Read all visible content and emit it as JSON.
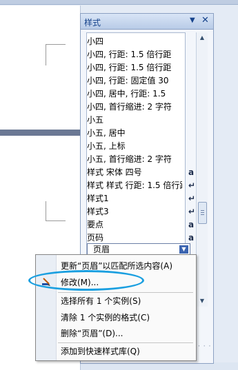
{
  "pane": {
    "title": "样式",
    "dropdown_glyph": "▼",
    "close_glyph": "✕"
  },
  "styles": [
    {
      "label": "小四",
      "mark": ""
    },
    {
      "label": "小四, 行距: 1.5 倍行距",
      "mark": ""
    },
    {
      "label": "小四, 行距: 1.5 倍行距",
      "mark": ""
    },
    {
      "label": "小四, 行距: 固定值 30",
      "mark": ""
    },
    {
      "label": "小四, 居中, 行距: 1.5",
      "mark": ""
    },
    {
      "label": "小四, 首行缩进: 2 字符",
      "mark": ""
    },
    {
      "label": "小五",
      "mark": ""
    },
    {
      "label": "小五, 居中",
      "mark": ""
    },
    {
      "label": "小五, 上标",
      "mark": ""
    },
    {
      "label": "小五, 首行缩进: 2 字符",
      "mark": ""
    },
    {
      "label": "样式 宋体 四号",
      "mark": "a"
    },
    {
      "label": "样式 样式 行距: 1.5 倍行距",
      "mark": "↵"
    },
    {
      "label": "样式1",
      "mark": "↵"
    },
    {
      "label": "样式3",
      "mark": "↵"
    },
    {
      "label": "要点",
      "mark": "a"
    },
    {
      "label": "页码",
      "mark": "a"
    }
  ],
  "selected_style": {
    "label": "页眉"
  },
  "context_menu": {
    "update": "更新“页眉”以匹配所选内容(A)",
    "modify": "修改(M)...",
    "select_all": "选择所有 1 个实例(S)",
    "clear": "清除 1 个实例的格式(C)",
    "delete": "删除“页眉”(D)...",
    "add_gallery": "添加到快速样式库(Q)"
  }
}
